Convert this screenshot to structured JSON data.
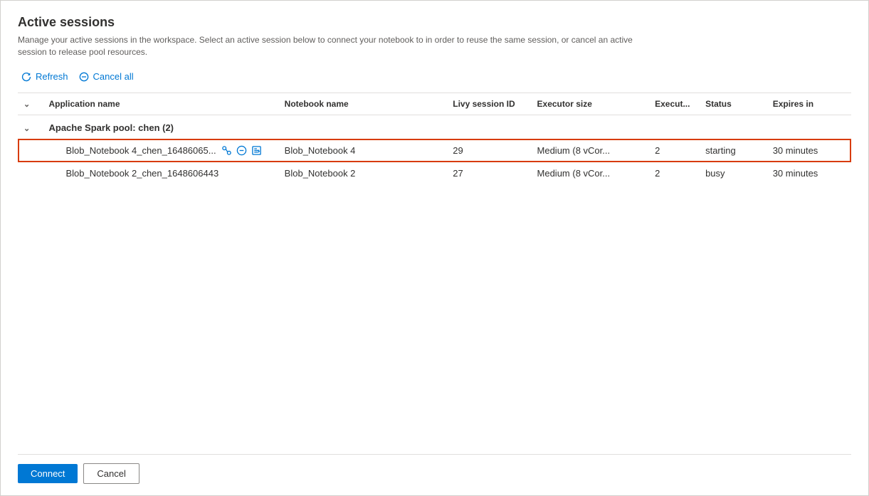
{
  "dialog": {
    "title": "Active sessions",
    "subtitle": "Manage your active sessions in the workspace. Select an active session below to connect your notebook to in order to reuse the same session, or cancel an active session to release pool resources.",
    "toolbar": {
      "refresh_label": "Refresh",
      "cancel_all_label": "Cancel all"
    },
    "table": {
      "columns": [
        {
          "id": "expand",
          "label": ""
        },
        {
          "id": "appname",
          "label": "Application name"
        },
        {
          "id": "notebook",
          "label": "Notebook name"
        },
        {
          "id": "livy",
          "label": "Livy session ID"
        },
        {
          "id": "executor_size",
          "label": "Executor size"
        },
        {
          "id": "execut",
          "label": "Execut..."
        },
        {
          "id": "status",
          "label": "Status"
        },
        {
          "id": "expires",
          "label": "Expires in"
        }
      ],
      "groups": [
        {
          "name": "Apache Spark pool: chen (2)",
          "rows": [
            {
              "appname": "Blob_Notebook 4_chen_16486065...",
              "notebook": "Blob_Notebook 4",
              "livy": "29",
              "executor_size": "Medium (8 vCor...",
              "execut": "2",
              "status": "starting",
              "expires": "30 minutes",
              "selected": true,
              "has_icons": true
            },
            {
              "appname": "Blob_Notebook 2_chen_1648606443",
              "notebook": "Blob_Notebook 2",
              "livy": "27",
              "executor_size": "Medium (8 vCor...",
              "execut": "2",
              "status": "busy",
              "expires": "30 minutes",
              "selected": false,
              "has_icons": false
            }
          ]
        }
      ]
    },
    "footer": {
      "connect_label": "Connect",
      "cancel_label": "Cancel"
    }
  }
}
